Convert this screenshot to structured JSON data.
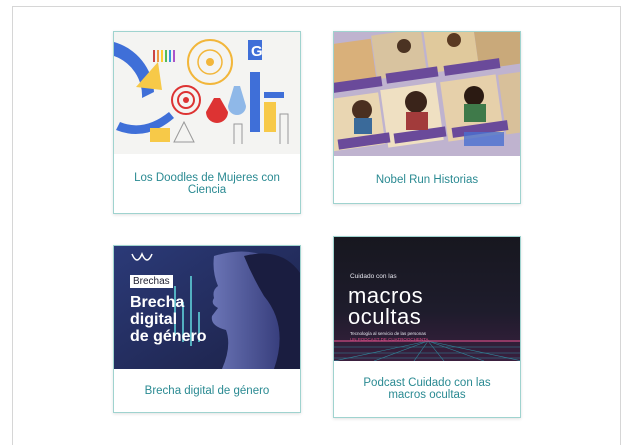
{
  "cards": [
    {
      "caption": "Los Doodles de Mujeres con Ciencia"
    },
    {
      "caption": "Nobel Run Historias"
    },
    {
      "caption": "Brecha digital de género",
      "thumb_tag": "Brechas",
      "thumb_title": "Brecha\ndigital\nde género"
    },
    {
      "caption": "Podcast Cuidado con las macros ocultas",
      "thumb_kicker": "Cuidado con las",
      "thumb_title": "macros\nocultas",
      "thumb_subtitle": "Tecnología al servicio de las personas",
      "thumb_subtitle2": "UN PODCAST DE CUATROOCHENTA"
    }
  ],
  "colors": {
    "caption_text": "#2a8a92",
    "card_border": "#9fd3cf",
    "brecha_bg": "#26305e",
    "macros_bg": "#1a1a26"
  }
}
